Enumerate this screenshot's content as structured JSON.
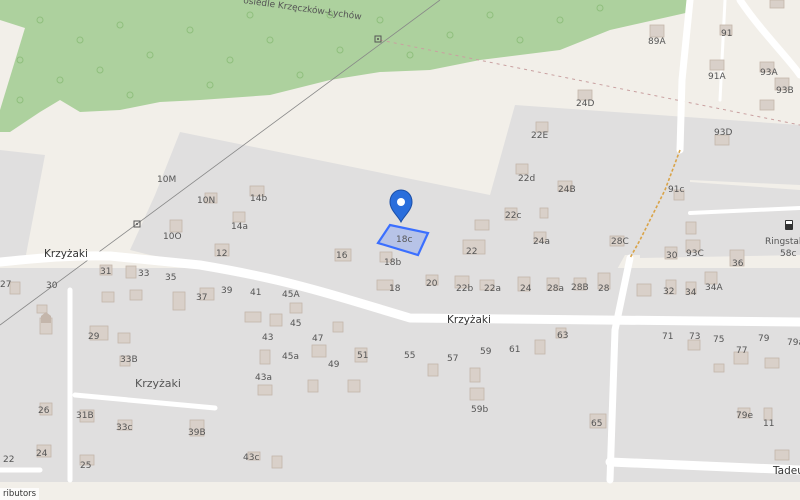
{
  "map": {
    "colors": {
      "background": "#f2efe9",
      "residential": "#e0dfdf",
      "forest": "#add19e",
      "building": "#d9d0c9",
      "building_stroke": "#c4b6ab",
      "road": "#ffffff",
      "highlight": "#3b6fff"
    },
    "streets": {
      "krzyzaki_west": "Krzyżaki",
      "krzyzaki_main": "Krzyżaki",
      "ringstal": "Ringstal",
      "ringstal_number": "58c",
      "tadeusza": "Tadeu"
    },
    "place_names": {
      "hamlet": "Krzyżaki",
      "osiedle": "osiedle Krzęczków-Łychów"
    },
    "marker": {
      "label": "18c",
      "icon": "map-pin-icon"
    },
    "house_numbers": [
      "89A",
      "91",
      "91A",
      "93A",
      "93B",
      "93D",
      "24D",
      "22E",
      "10M",
      "10N",
      "14b",
      "14a",
      "22d",
      "24B",
      "22c",
      "24a",
      "28C",
      "91c",
      "93C",
      "10O",
      "12",
      "16",
      "18b",
      "22",
      "30",
      "36",
      "18",
      "20",
      "22b",
      "22a",
      "24",
      "28a",
      "28B",
      "28",
      "32",
      "34",
      "34A",
      "31",
      "33",
      "35",
      "37",
      "39",
      "41",
      "45A",
      "30",
      "27",
      "29",
      "33B",
      "45",
      "43",
      "47",
      "45a",
      "49",
      "51",
      "55",
      "57",
      "59",
      "61",
      "63",
      "71",
      "73",
      "75",
      "77",
      "79",
      "79a",
      "43a",
      "26",
      "31B",
      "33c",
      "39B",
      "59b",
      "65",
      "79e",
      "11",
      "22",
      "24",
      "25",
      "43c"
    ],
    "attribution": "ributors"
  }
}
